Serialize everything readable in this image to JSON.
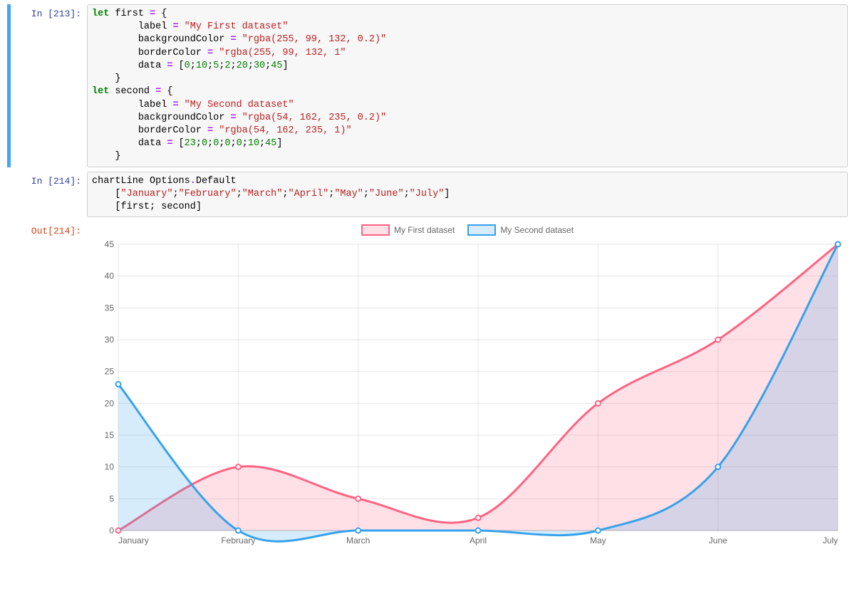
{
  "cells": {
    "c213": {
      "prompt": "In [213]:",
      "tokens": [
        [
          [
            "kw",
            "let"
          ],
          [
            "nm",
            " first "
          ],
          [
            "op",
            "="
          ],
          [
            "p",
            " {"
          ]
        ],
        [
          [
            "p",
            "        "
          ],
          [
            "nm",
            "label"
          ],
          [
            "nm",
            " "
          ],
          [
            "op",
            "="
          ],
          [
            "nm",
            " "
          ],
          [
            "str",
            "\"My First dataset\""
          ]
        ],
        [
          [
            "p",
            "        "
          ],
          [
            "nm",
            "backgroundColor"
          ],
          [
            "nm",
            " "
          ],
          [
            "op",
            "="
          ],
          [
            "nm",
            " "
          ],
          [
            "str",
            "\"rgba(255, 99, 132, 0.2)\""
          ]
        ],
        [
          [
            "p",
            "        "
          ],
          [
            "nm",
            "borderColor"
          ],
          [
            "nm",
            " "
          ],
          [
            "op",
            "="
          ],
          [
            "nm",
            " "
          ],
          [
            "str",
            "\"rgba(255, 99, 132, 1\""
          ]
        ],
        [
          [
            "p",
            "        "
          ],
          [
            "nm",
            "data"
          ],
          [
            "nm",
            " "
          ],
          [
            "op",
            "="
          ],
          [
            "nm",
            " "
          ],
          [
            "p",
            "["
          ],
          [
            "num",
            "0"
          ],
          [
            "p",
            ";"
          ],
          [
            "num",
            "10"
          ],
          [
            "p",
            ";"
          ],
          [
            "num",
            "5"
          ],
          [
            "p",
            ";"
          ],
          [
            "num",
            "2"
          ],
          [
            "p",
            ";"
          ],
          [
            "num",
            "20"
          ],
          [
            "p",
            ";"
          ],
          [
            "num",
            "30"
          ],
          [
            "p",
            ";"
          ],
          [
            "num",
            "45"
          ],
          [
            "p",
            "]"
          ]
        ],
        [
          [
            "p",
            "    }"
          ]
        ],
        [
          [
            "kw",
            "let"
          ],
          [
            "nm",
            " second "
          ],
          [
            "op",
            "="
          ],
          [
            "p",
            " {"
          ]
        ],
        [
          [
            "p",
            "        "
          ],
          [
            "nm",
            "label"
          ],
          [
            "nm",
            " "
          ],
          [
            "op",
            "="
          ],
          [
            "nm",
            " "
          ],
          [
            "str",
            "\"My Second dataset\""
          ]
        ],
        [
          [
            "p",
            "        "
          ],
          [
            "nm",
            "backgroundColor"
          ],
          [
            "nm",
            " "
          ],
          [
            "op",
            "="
          ],
          [
            "nm",
            " "
          ],
          [
            "str",
            "\"rgba(54, 162, 235, 0.2)\""
          ]
        ],
        [
          [
            "p",
            "        "
          ],
          [
            "nm",
            "borderColor"
          ],
          [
            "nm",
            " "
          ],
          [
            "op",
            "="
          ],
          [
            "nm",
            " "
          ],
          [
            "str",
            "\"rgba(54, 162, 235, 1)\""
          ]
        ],
        [
          [
            "p",
            "        "
          ],
          [
            "nm",
            "data"
          ],
          [
            "nm",
            " "
          ],
          [
            "op",
            "="
          ],
          [
            "nm",
            " "
          ],
          [
            "p",
            "["
          ],
          [
            "num",
            "23"
          ],
          [
            "p",
            ";"
          ],
          [
            "num",
            "0"
          ],
          [
            "p",
            ";"
          ],
          [
            "num",
            "0"
          ],
          [
            "p",
            ";"
          ],
          [
            "num",
            "0"
          ],
          [
            "p",
            ";"
          ],
          [
            "num",
            "0"
          ],
          [
            "p",
            ";"
          ],
          [
            "num",
            "10"
          ],
          [
            "p",
            ";"
          ],
          [
            "num",
            "45"
          ],
          [
            "p",
            "]"
          ]
        ],
        [
          [
            "p",
            "    }"
          ]
        ]
      ]
    },
    "c214": {
      "prompt": "In [214]:",
      "tokens": [
        [
          [
            "nm",
            "chartLine Options"
          ],
          [
            "op",
            "."
          ],
          [
            "nm",
            "Default"
          ]
        ],
        [
          [
            "p",
            "    ["
          ],
          [
            "str",
            "\"January\""
          ],
          [
            "p",
            ";"
          ],
          [
            "str",
            "\"February\""
          ],
          [
            "p",
            ";"
          ],
          [
            "str",
            "\"March\""
          ],
          [
            "p",
            ";"
          ],
          [
            "str",
            "\"April\""
          ],
          [
            "p",
            ";"
          ],
          [
            "str",
            "\"May\""
          ],
          [
            "p",
            ";"
          ],
          [
            "str",
            "\"June\""
          ],
          [
            "p",
            ";"
          ],
          [
            "str",
            "\"July\""
          ],
          [
            "p",
            "]"
          ]
        ],
        [
          [
            "p",
            "    ["
          ],
          [
            "nm",
            "first"
          ],
          [
            "p",
            "; "
          ],
          [
            "nm",
            "second"
          ],
          [
            "p",
            "]"
          ]
        ]
      ]
    },
    "out214": {
      "prompt": "Out[214]:"
    }
  },
  "chart_data": {
    "type": "line",
    "categories": [
      "January",
      "February",
      "March",
      "April",
      "May",
      "June",
      "July"
    ],
    "series": [
      {
        "name": "My First dataset",
        "values": [
          0,
          10,
          5,
          2,
          20,
          30,
          45
        ],
        "borderColor": "rgba(255, 99, 132, 1)",
        "backgroundColor": "rgba(255, 99, 132, 0.2)"
      },
      {
        "name": "My Second dataset",
        "values": [
          23,
          0,
          0,
          0,
          0,
          10,
          45
        ],
        "borderColor": "rgba(54, 162, 235, 1)",
        "backgroundColor": "rgba(54, 162, 235, 0.2)"
      }
    ],
    "ylim": [
      0,
      45
    ],
    "yticks": [
      0,
      5,
      10,
      15,
      20,
      25,
      30,
      35,
      40,
      45
    ],
    "title": "",
    "xlabel": "",
    "ylabel": "",
    "legend": true,
    "fill": true
  }
}
